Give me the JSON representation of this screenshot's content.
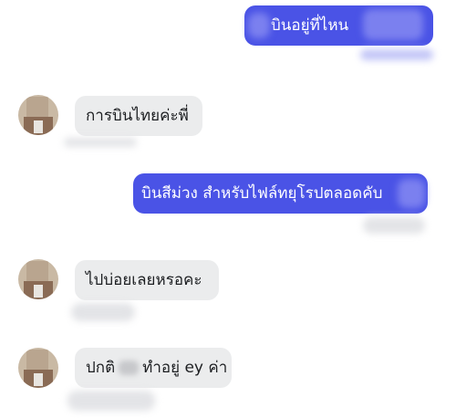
{
  "colors": {
    "outgoing_bubble": "#4a53e6",
    "incoming_bubble": "#ebeced",
    "outgoing_text": "#ffffff",
    "incoming_text": "#1c1e21"
  },
  "messages": [
    {
      "direction": "outgoing",
      "text": "บินอยู่ที่ไหน"
    },
    {
      "direction": "incoming",
      "text": "การบินไทยค่ะพี่"
    },
    {
      "direction": "outgoing",
      "text": "บินสีม่วง สำหรับไฟล์ทยุโรปตลอดคับ"
    },
    {
      "direction": "incoming",
      "text": "ไปบ่อยเลยหรอคะ"
    },
    {
      "direction": "incoming",
      "text_before": "ปกติ",
      "text_after": "ทำอยู่ ey ค่า"
    }
  ]
}
